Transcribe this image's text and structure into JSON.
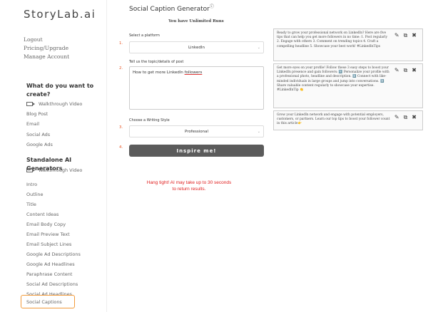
{
  "sidebar": {
    "logo": "StoryLab.ai",
    "account": [
      "Logout",
      "Pricing/Upgrade",
      "Manage Account"
    ],
    "what_title_1": "What do you want to",
    "what_title_2": "create?",
    "what_items": [
      "Walkthrough Video",
      "Blog Post",
      "Email",
      "Social Ads",
      "Google Ads"
    ],
    "standalone_title": "Standalone AI Generators",
    "standalone_items": [
      "Walkthrough Video",
      "Intro",
      "Outline",
      "Title",
      "Content Ideas",
      "Email Body Copy",
      "Email Preview Text",
      "Email Subject Lines",
      "Google Ad Descriptions",
      "Google Ad Headlines",
      "Paraphrase Content",
      "Social Ad Descriptions",
      "Social Ad Headlines",
      "Social Captions"
    ]
  },
  "main": {
    "title": "Social Caption Generator",
    "title_info_icon": "ⓘ",
    "unlimited": "You have Unlimited Runs",
    "step1_num": "1.",
    "step1_label": "Select a platform",
    "platform_value": "LinkedIn",
    "step2_num": "2.",
    "step2_label": "Tell us the topic/details of post",
    "topic_pre": "How to get more LinkedIn ",
    "topic_underlined": "followers",
    "step3_num": "3.",
    "step3_label": "Choose a Writing Style",
    "style_value": "Professional",
    "step4_num": "4.",
    "inspire_label": "Inspire me!",
    "wait_line1": "Hang tight! AI may take up to 30 seconds",
    "wait_line2": "to return results."
  },
  "results": [
    {
      "text": "Ready to grow your professional network on LinkedIn? Here are five tips that can help you get more followers in no time: 1. Post regularly 2. Engage with others 3. Comment on trending topics 4. Craft a compelling headline 5. Showcase your best work! #LinkedInTips"
    },
    {
      "text": "Get more eyes on your profile! Follow these 3 easy steps to boost your LinkedIn presence and gain followers: 1️⃣ Personalize your profile with a professional photo, headline and description. 2️⃣ Connect with like-minded individuals in large groups and jump into conversations. 3️⃣ Share valuable content regularly to showcase your expertise. #LinkedInTip 👏"
    },
    {
      "text": "Grow your LinkedIn network and engage with potential employers, customers, or partners. Learn our top tips to boost your follower count in this article👉"
    }
  ],
  "icons": {
    "edit": "edit-icon",
    "copy": "copy-icon",
    "close": "close-icon",
    "video": "video-icon"
  },
  "colors": {
    "accent_orange": "#f29a3a",
    "step_red": "#e85a2a",
    "wait_red": "#e02020",
    "button_gray": "#5b5b5b"
  }
}
